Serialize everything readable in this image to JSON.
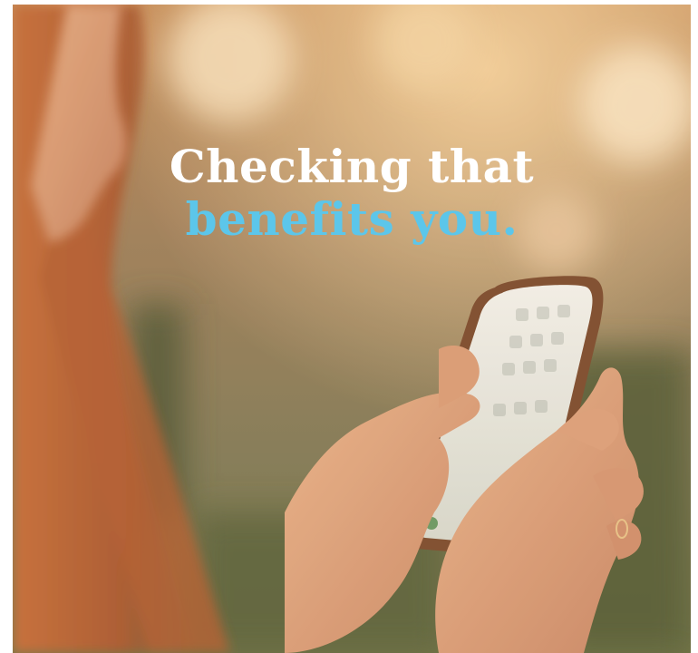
{
  "headline": {
    "line1": "Checking that",
    "line2": "benefits you."
  },
  "colors": {
    "headline_primary": "#ffffff",
    "headline_accent": "#5cc6ea",
    "background_warm": "#c8955a",
    "background_green": "#6f7848"
  },
  "image": {
    "subject": "woman-holding-smartphone",
    "device": "phone-icon"
  }
}
